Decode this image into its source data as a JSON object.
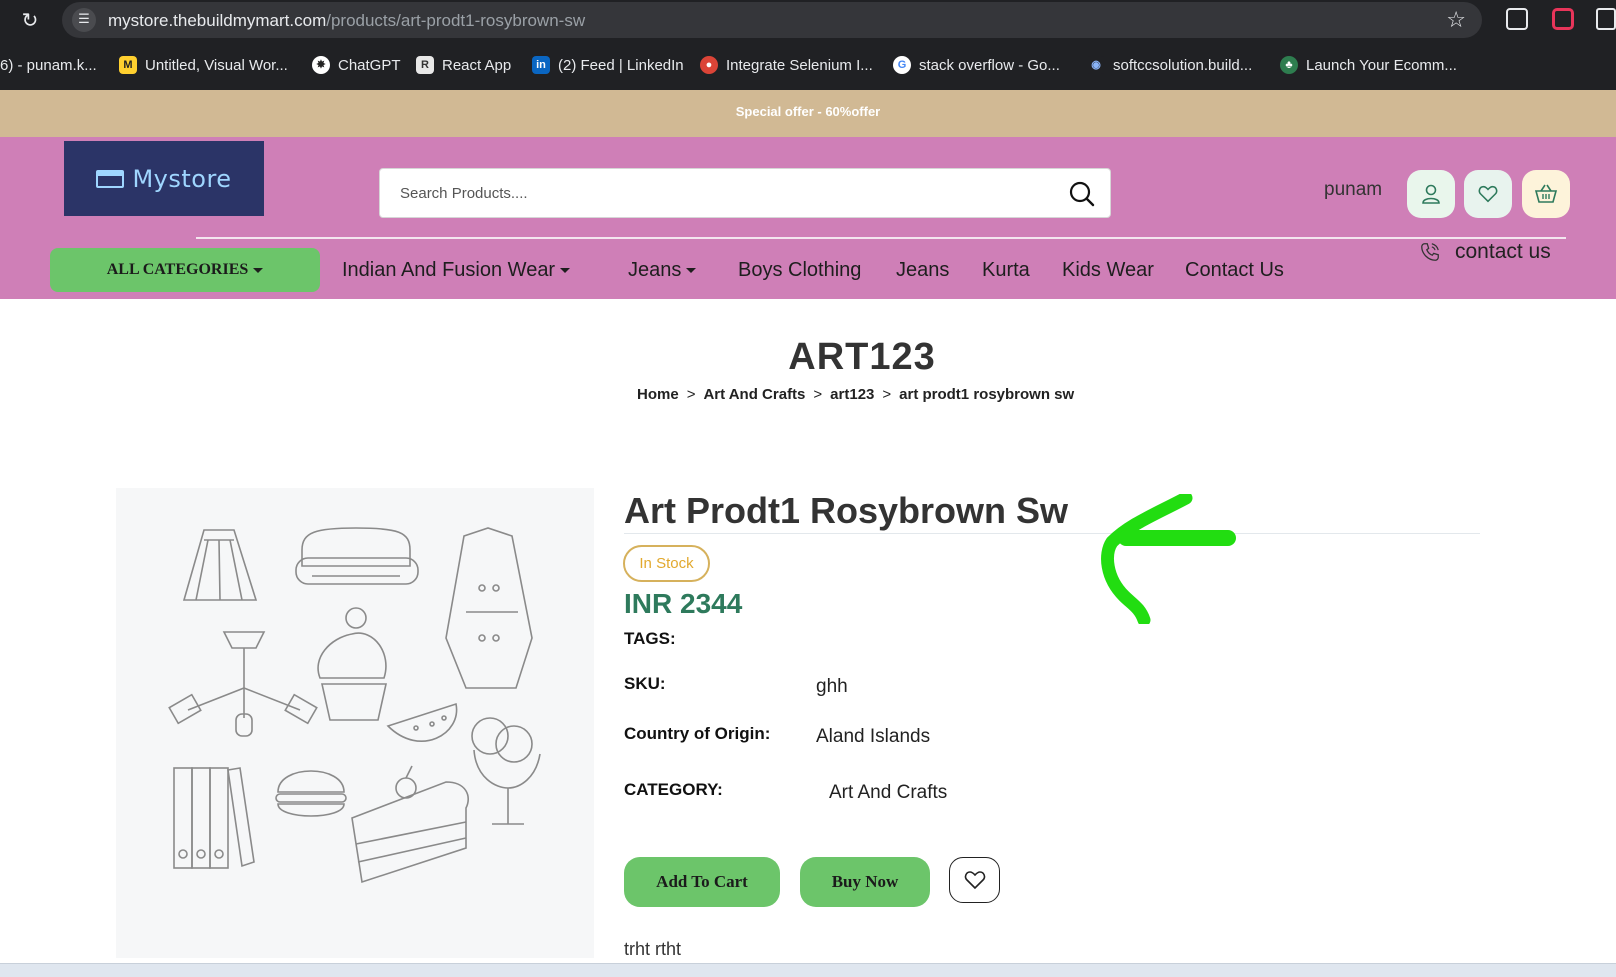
{
  "browser": {
    "url_main": "mystore.thebuildmymart.com",
    "url_path": "/products/art-prodt1-rosybrown-sw",
    "bookmarks": [
      {
        "label": "6) - punam.k...",
        "icon": "mail-icon"
      },
      {
        "label": "Untitled, Visual Wor...",
        "icon": "miro-icon"
      },
      {
        "label": "ChatGPT",
        "icon": "chatgpt-icon"
      },
      {
        "label": "React App",
        "icon": "react-app-icon"
      },
      {
        "label": "(2) Feed | LinkedIn",
        "icon": "linkedin-icon"
      },
      {
        "label": "Integrate Selenium I...",
        "icon": "chrome-icon"
      },
      {
        "label": "stack overflow - Go...",
        "icon": "google-icon"
      },
      {
        "label": "softccsolution.build...",
        "icon": "site-icon"
      },
      {
        "label": "Launch Your Ecomm...",
        "icon": "store-icon"
      }
    ]
  },
  "offer": {
    "text": "Special offer - 60%offer"
  },
  "header": {
    "logo_text": "Mystore",
    "search_placeholder": "Search Products....",
    "username": "punam",
    "all_categories": "ALL CATEGORIES",
    "nav": [
      {
        "label": "Indian And Fusion Wear",
        "dropdown": true
      },
      {
        "label": "Jeans",
        "dropdown": true
      },
      {
        "label": "Boys Clothing",
        "dropdown": false
      },
      {
        "label": "Jeans",
        "dropdown": false
      },
      {
        "label": "Kurta",
        "dropdown": false
      },
      {
        "label": "Kids Wear",
        "dropdown": false
      },
      {
        "label": "Contact Us",
        "dropdown": false
      }
    ],
    "contact": "contact us"
  },
  "page": {
    "title": "ART123",
    "breadcrumb": [
      "Home",
      "Art And Crafts",
      "art123",
      "art prodt1 rosybrown sw"
    ]
  },
  "product": {
    "name": "Art Prodt1 Rosybrown Sw",
    "stock": "In Stock",
    "price": "INR 2344",
    "tags_label": "TAGS:",
    "sku_label": "SKU:",
    "sku": "ghh",
    "origin_label": "Country of Origin:",
    "origin": "Aland Islands",
    "category_label": "CATEGORY:",
    "category": "Art And Crafts",
    "add_to_cart": "Add To Cart",
    "buy_now": "Buy Now",
    "description": "trht rtht"
  },
  "colors": {
    "header_bg": "#cf7fb7",
    "offer_bg": "#d1b994",
    "button_green": "#6cc56a",
    "price_green": "#2e7a5c",
    "logo_bg": "#2b3467",
    "annotation_arrow": "#22dd11"
  }
}
